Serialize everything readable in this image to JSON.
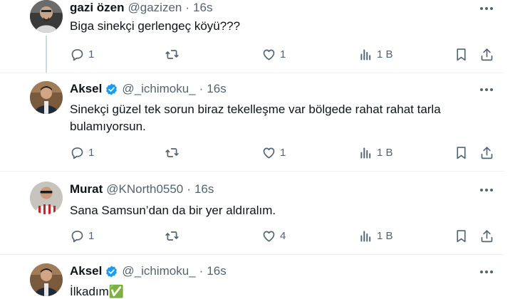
{
  "tweets": [
    {
      "name": "gazi özen",
      "handle": "@gazizen",
      "separator": "·",
      "time": "16s",
      "verified": false,
      "text": "Biga sinekçi gerlengeç köyü???",
      "replies": "1",
      "retweets": "",
      "likes": "1",
      "views": "1 B"
    },
    {
      "name": "Aksel",
      "handle": "@_ichimoku_",
      "separator": "·",
      "time": "16s",
      "verified": true,
      "text": "Sinekçi güzel tek sorun biraz tekelleşme var bölgede rahat rahat tarla bulamıyorsun.",
      "replies": "1",
      "retweets": "",
      "likes": "1",
      "views": "1 B"
    },
    {
      "name": "Murat",
      "handle": "@KNorth0550",
      "separator": "·",
      "time": "16s",
      "verified": false,
      "text": "Sana Samsun’dan da bir yer aldıralım.",
      "replies": "1",
      "retweets": "",
      "likes": "4",
      "views": "1 B"
    },
    {
      "name": "Aksel",
      "handle": "@_ichimoku_",
      "separator": "·",
      "time": "16s",
      "verified": true,
      "text": "İlkadım✅",
      "replies": "",
      "retweets": "",
      "likes": "",
      "views": ""
    }
  ],
  "icons": {
    "reply": "reply-icon",
    "retweet": "retweet-icon",
    "like": "heart-icon",
    "views": "views-icon",
    "bookmark": "bookmark-icon",
    "share": "share-icon",
    "more": "more-icon",
    "verified": "verified-badge-icon"
  },
  "colors": {
    "text": "#0f1419",
    "secondary": "#536471",
    "verified": "#1d9bf0",
    "divider": "#eff3f4",
    "thread_line": "#cfd9de"
  }
}
